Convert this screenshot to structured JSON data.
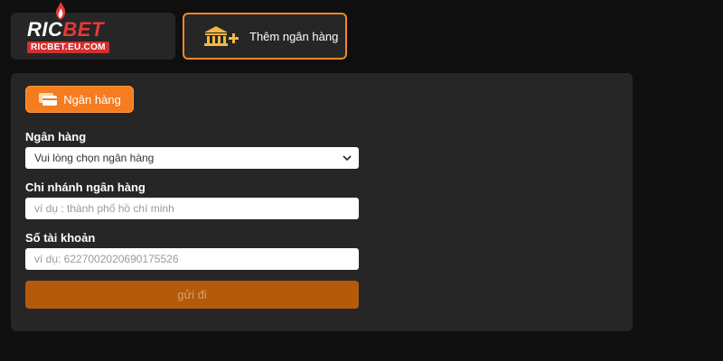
{
  "brand": {
    "name_main": "RIC",
    "name_accent": "BET",
    "url": "RICBET.EU.COM"
  },
  "top": {
    "add_bank_label": "Thêm ngân hàng"
  },
  "panel": {
    "tab_label": "Ngân hàng",
    "bank": {
      "label": "Ngân hàng",
      "value": "Vui lòng chọn ngân hàng"
    },
    "branch": {
      "label": "Chi nhánh ngân hàng",
      "placeholder": "ví dụ : thành phố hồ chí minh"
    },
    "account": {
      "label": "Số tài khoản",
      "placeholder": "ví dụ:  6227002020690175526"
    },
    "submit_label": "gửi đi"
  },
  "colors": {
    "accent": "#f57c1f",
    "submit_bg": "#b45a0a",
    "panel_bg": "#262626",
    "page_bg": "#0f0f0f"
  }
}
